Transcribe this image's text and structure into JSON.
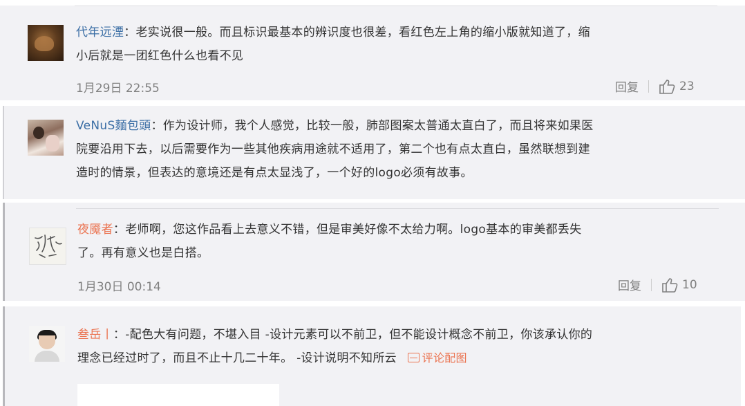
{
  "comments": [
    {
      "username": "代年远湮",
      "text_line1": "：老实说很一般。而且标识最基本的辨识度也很差，看红色左上角的缩小版就知道了，缩",
      "text_line2": "小后就是一团红色什么也看不见",
      "date": "1月29日 22:55",
      "reply_label": "回复",
      "likes": "23"
    },
    {
      "username": "VeNuS麵包頭",
      "text_line1": "：作为设计师，我个人感觉，比较一般，肺部图案太普通太直白了，而且将来如果医",
      "text_line2": "院要沿用下去，以后需要作为一些其他疾病用途就不适用了，第二个也有点太直白，虽然联想到建",
      "text_line3": "造时的情景，但表达的意境还是有点太显浅了，一个好的logo必须有故事。"
    },
    {
      "username": "夜魇者",
      "text_line1": "：老师啊，您这作品看上去意义不错，但是审美好像不太给力啊。logo基本的审美都丢失",
      "text_line2": "了。再有意义也是白搭。",
      "date": "1月30日 00:14",
      "reply_label": "回复",
      "likes": "10"
    },
    {
      "username": "叁岳丨",
      "text_line1": "：-配色大有问题，不堪入目 -设计元素可以不前卫，但不能设计概念不前卫，你该承认你的",
      "text_line2": "理念已经过时了，而且不止十几二十年。 -设计说明不知所云",
      "pic_link": "评论配图"
    }
  ],
  "colors": {
    "username_orange": "#eb7350",
    "username_blue": "#3b6ea5",
    "panel_bg": "#f2f2f5"
  }
}
